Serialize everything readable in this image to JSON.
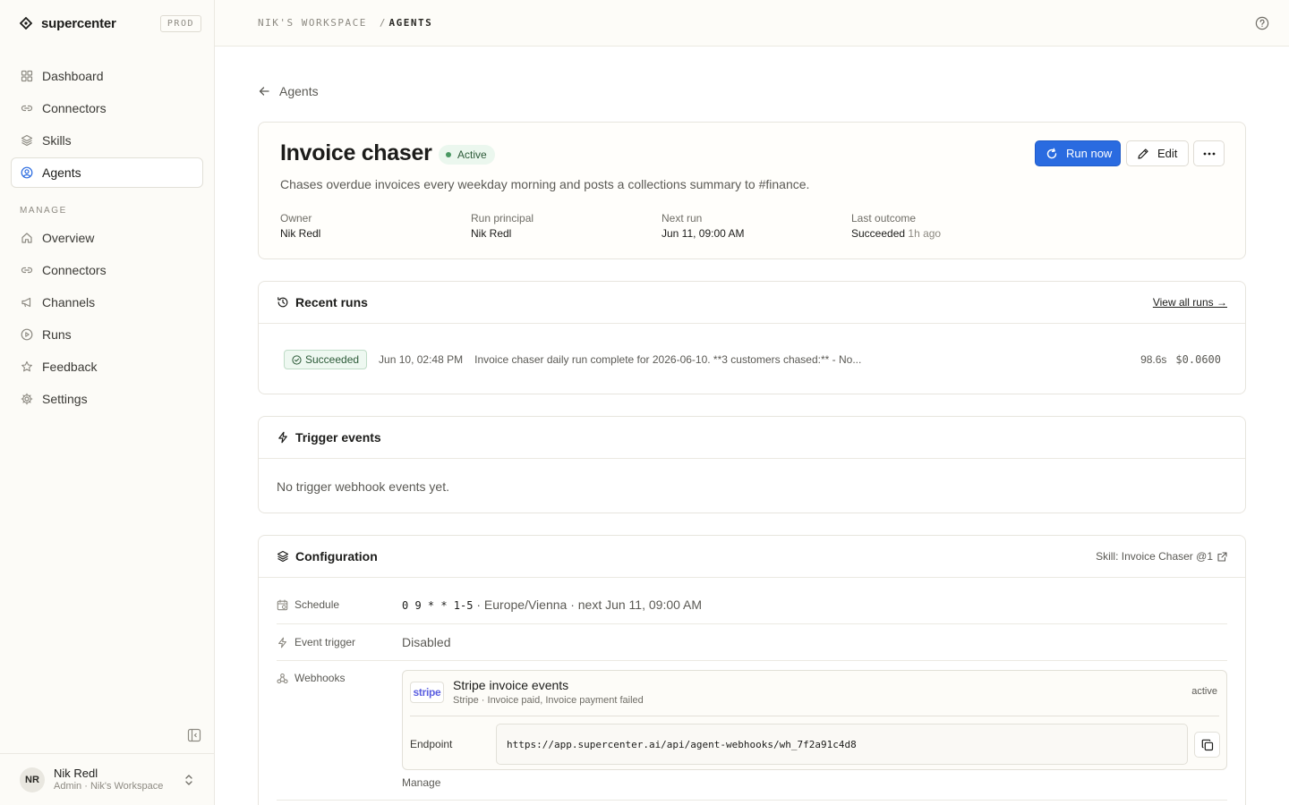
{
  "app": {
    "name": "supercenter",
    "env": "PROD"
  },
  "sidebar": {
    "items": [
      {
        "label": "Dashboard",
        "icon": "grid-icon"
      },
      {
        "label": "Connectors",
        "icon": "link-icon"
      },
      {
        "label": "Skills",
        "icon": "layers-icon"
      },
      {
        "label": "Agents",
        "icon": "user-circle-icon",
        "active": true
      }
    ],
    "manage_label": "MANAGE",
    "manage_items": [
      {
        "label": "Overview",
        "icon": "home-icon"
      },
      {
        "label": "Connectors",
        "icon": "link-icon"
      },
      {
        "label": "Channels",
        "icon": "megaphone-icon"
      },
      {
        "label": "Runs",
        "icon": "play-circle-icon"
      },
      {
        "label": "Feedback",
        "icon": "star-icon"
      },
      {
        "label": "Settings",
        "icon": "gear-icon"
      }
    ]
  },
  "user": {
    "initials": "NR",
    "name": "Nik Redl",
    "role": "Admin · Nik's Workspace"
  },
  "breadcrumb": {
    "workspace": "NIK'S WORKSPACE",
    "separator": "/",
    "current": "AGENTS"
  },
  "back": {
    "label": "Agents"
  },
  "agent": {
    "title": "Invoice chaser",
    "status": "Active",
    "description": "Chases overdue invoices every weekday morning and posts a collections summary to #finance.",
    "actions": {
      "run": "Run now",
      "edit": "Edit",
      "more": "···"
    },
    "meta": [
      {
        "label": "Owner",
        "value": "Nik Redl",
        "suffix": ""
      },
      {
        "label": "Run principal",
        "value": "Nik Redl",
        "suffix": ""
      },
      {
        "label": "Next run",
        "value": "Jun 11, 09:00 AM",
        "suffix": ""
      },
      {
        "label": "Last outcome",
        "value": "Succeeded",
        "suffix": "1h ago"
      }
    ]
  },
  "recent_runs": {
    "title": "Recent runs",
    "view_all": "View all runs →",
    "rows": [
      {
        "status": "Succeeded",
        "time": "Jun 10, 02:48 PM",
        "message": "Invoice chaser daily run complete for 2026-06-10. **3 customers chased:** - No...",
        "duration": "98.6s",
        "cost": "$0.0600"
      }
    ]
  },
  "trigger_events": {
    "title": "Trigger events",
    "empty": "No trigger webhook events yet."
  },
  "configuration": {
    "title": "Configuration",
    "skill_link": "Skill: Invoice Chaser @1",
    "schedule": {
      "label": "Schedule",
      "cron": "0 9 * * 1-5",
      "detail": "· Europe/Vienna · next Jun 11, 09:00 AM"
    },
    "event_trigger": {
      "label": "Event trigger",
      "value": "Disabled"
    },
    "webhooks": {
      "label": "Webhooks",
      "logo": "stripe",
      "name": "Stripe invoice events",
      "sub": "Stripe · Invoice paid, Invoice payment failed",
      "status": "active",
      "endpoint_label": "Endpoint",
      "endpoint": "https://app.supercenter.ai/api/agent-webhooks/wh_7f2a91c4d8",
      "manage": "Manage"
    }
  },
  "colors": {
    "primary": "#2a6be0",
    "success_bg": "#ebf7ee",
    "success_text": "#2c5a38",
    "sidebar_bg": "#fcfbf7"
  }
}
